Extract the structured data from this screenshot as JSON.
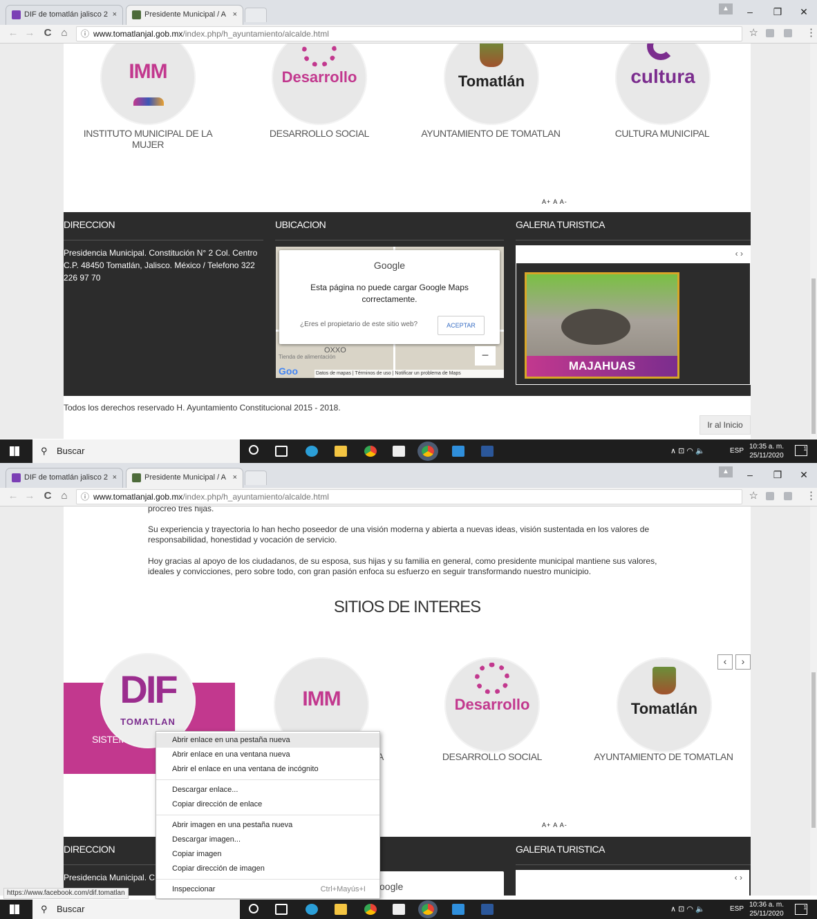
{
  "browser": {
    "tab1_title": "DIF de tomatlán jalisco 2",
    "tab2_title": "Presidente Municipal / A",
    "tab_close": "×",
    "url_host": "www.tomatlanjal.gob.mx",
    "url_path": "/index.php/h_ayuntamiento/alcalde.html",
    "info_icon": "ⓘ",
    "back_icon": "←",
    "forward_icon": "→",
    "reload_icon": "C",
    "home_icon": "⌂",
    "star_icon": "☆",
    "menu_icon": "⋮",
    "minimize": "–",
    "restore": "❐",
    "close": "✕"
  },
  "colors": {
    "accent": "#c2388e",
    "dark_footer": "#2c2c2c",
    "taskbar": "#1e1e1e"
  },
  "screen1": {
    "sites": [
      {
        "logo": "IMM",
        "label": "INSTITUTO MUNICIPAL DE LA MUJER"
      },
      {
        "logo": "Desarrollo",
        "label": "DESARROLLO SOCIAL"
      },
      {
        "logo": "Tomatlán",
        "label": "AYUNTAMIENTO DE TOMATLAN"
      },
      {
        "logo": "cultura",
        "label": "CULTURA MUNICIPAL"
      }
    ],
    "font_controls": "A+ A A-",
    "footer": {
      "col1_title": "DIRECCION",
      "col2_title": "UBICACION",
      "col3_title": "GALERIA TURISTICA",
      "address": "Presidencia Municipal. Constitución N° 2 Col. Centro C.P. 48450 Tomatlán, Jalisco. México / Telefono 322 226 97 70",
      "map_google": "Google",
      "map_error": "Esta página no puede cargar Google Maps correctamente.",
      "map_owner": "¿Eres el propietario de este sitio web?",
      "map_accept": "ACEPTAR",
      "map_place": "OXXO",
      "map_place_type": "Tienda de alimentación",
      "map_terms": "Datos de mapas  |  Términos de uso  |  Notificar un problema de Maps",
      "gallery_arrows": "‹  ›",
      "gallery_caption": "MAJAHUAS",
      "copyright": "Todos los derechos reservado H. Ayuntamiento Constitucional 2015 - 2018.",
      "top_button": "Ir al Inicio"
    }
  },
  "screen2": {
    "paragraphs": [
      "procreó tres hijas.",
      "Su experiencia y trayectoria lo han hecho poseedor de una visión moderna y abierta a nuevas ideas, visión sustentada en los valores de responsabilidad, honestidad y vocación de servicio.",
      "Hoy gracias al apoyo de los ciudadanos, de su esposa, sus hijas y su familia en general, como presidente municipal mantiene sus valores, ideales y convicciones, pero sobre todo, con gran pasión enfoca su esfuerzo en seguir transformando nuestro municipio."
    ],
    "section_title": "SITIOS DE INTERES",
    "carousel_prev": "‹",
    "carousel_next": "›",
    "sites": [
      {
        "logo": "DIF",
        "sublogo": "TOMATLAN",
        "label": "SISTEMA DIF T"
      },
      {
        "logo": "IMM",
        "label": "A"
      },
      {
        "logo": "Desarrollo",
        "label": "DESARROLLO SOCIAL"
      },
      {
        "logo": "Tomatlán",
        "label": "AYUNTAMIENTO DE TOMATLAN"
      }
    ],
    "font_controls": "A+ A A-",
    "footer_col1": "DIRECCION",
    "footer_col3": "GALERIA TURISTICA",
    "footer_address_start": "Presidencia Municipal. C",
    "map_google": "oogle",
    "gallery_arrows": "‹  ›",
    "status_url": "https://www.facebook.com/dif.tomatlan",
    "context_menu": {
      "group1": [
        "Abrir enlace en una pestaña nueva",
        "Abrir enlace en una ventana nueva",
        "Abrir el enlace en una ventana de incógnito"
      ],
      "group2": [
        "Descargar enlace...",
        "Copiar dirección de enlace"
      ],
      "group3": [
        "Abrir imagen en una pestaña nueva",
        "Descargar imagen...",
        "Copiar imagen",
        "Copiar dirección de imagen"
      ],
      "inspect": "Inspeccionar",
      "inspect_shortcut": "Ctrl+Mayús+I"
    }
  },
  "taskbar": {
    "search_label": "Buscar",
    "lang": "ESP",
    "time1": "10:35 a. m.",
    "date1": "25/11/2020",
    "time2": "10:36 a. m.",
    "date2": "25/11/2020",
    "tray_icons": "∧  ⊡  ◠  🔈",
    "notif_count": "1"
  }
}
